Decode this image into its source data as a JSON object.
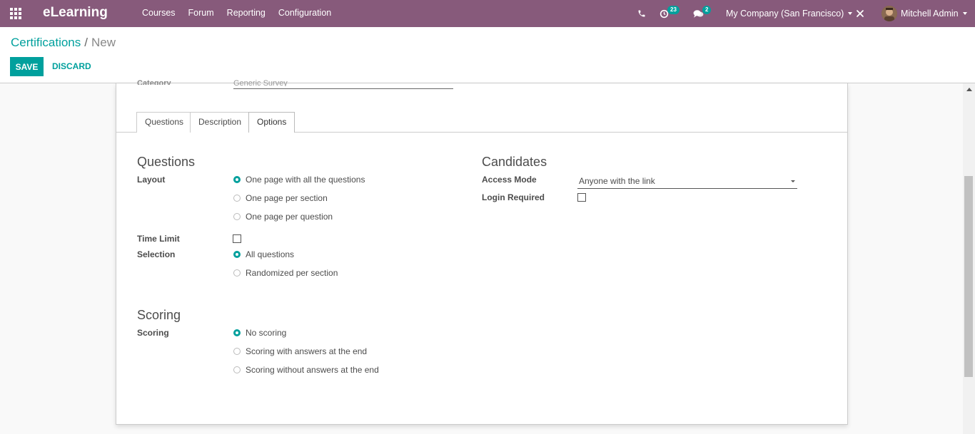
{
  "app": {
    "name": "eLearning"
  },
  "menu": [
    "Courses",
    "Forum",
    "Reporting",
    "Configuration"
  ],
  "systray": {
    "activity_count": "23",
    "message_count": "2",
    "company": "My Company (San Francisco)",
    "user": "Mitchell Admin"
  },
  "breadcrumb": {
    "parent": "Certifications",
    "separator": "/",
    "current": "New"
  },
  "buttons": {
    "save": "SAVE",
    "discard": "DISCARD"
  },
  "hidden_field": {
    "label": "Category",
    "value": "Generic Survey"
  },
  "tabs": [
    "Questions",
    "Description",
    "Options"
  ],
  "options": {
    "questions_title": "Questions",
    "layout_label": "Layout",
    "layout_options": [
      "One page with all the questions",
      "One page per section",
      "One page per question"
    ],
    "time_limit_label": "Time Limit",
    "selection_label": "Selection",
    "selection_options": [
      "All questions",
      "Randomized per section"
    ],
    "scoring_title": "Scoring",
    "scoring_label": "Scoring",
    "scoring_options": [
      "No scoring",
      "Scoring with answers at the end",
      "Scoring without answers at the end"
    ],
    "candidates_title": "Candidates",
    "access_mode_label": "Access Mode",
    "access_mode_value": "Anyone with the link",
    "login_required_label": "Login Required"
  },
  "colors": {
    "navbar": "#875a7b",
    "accent": "#00a09d"
  }
}
